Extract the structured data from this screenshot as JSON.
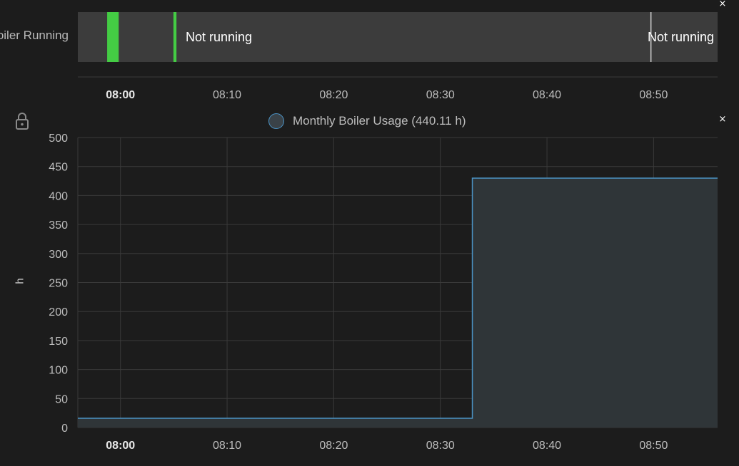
{
  "timeline": {
    "entity_label": "Boiler Running",
    "close_label": "×",
    "segments": [
      {
        "start": "07:58:45",
        "end": "07:59:50",
        "state": "Running",
        "color": "#44cc44"
      },
      {
        "start": "08:00:10",
        "end": "08:04:58",
        "state": "Not running",
        "color": "#3c3c3c"
      },
      {
        "start": "08:04:58",
        "end": "08:05:15",
        "state": "Running",
        "color": "#44cc44"
      },
      {
        "start": "08:05:15",
        "end": "08:49:45",
        "state": "Not running",
        "color": "#3c3c3c"
      },
      {
        "start": "08:49:45",
        "end": "08:56:00",
        "state": "Not running",
        "color": "#3c3c3c"
      }
    ],
    "segment_text": [
      "Not running",
      "Not running"
    ],
    "ticks": [
      "08:00",
      "08:10",
      "08:20",
      "08:30",
      "08:40",
      "08:50"
    ]
  },
  "chart_data": {
    "type": "area",
    "step": true,
    "legend": "Monthly Boiler Usage (440.11 h)",
    "ylabel": "h",
    "xlabel": "",
    "x_ticks": [
      "08:00",
      "08:10",
      "08:20",
      "08:30",
      "08:40",
      "08:50"
    ],
    "x_range": [
      "07:56",
      "08:56"
    ],
    "ylim": [
      0,
      500
    ],
    "y_ticks": [
      0,
      50,
      100,
      150,
      200,
      250,
      300,
      350,
      400,
      450,
      500
    ],
    "grid": true,
    "series": [
      {
        "name": "Monthly Boiler Usage (440.11 h)",
        "color": "#4b93c5",
        "fill": "#2f3538",
        "points": [
          {
            "x": "07:56",
            "y": 16
          },
          {
            "x": "08:33",
            "y": 16
          },
          {
            "x": "08:33",
            "y": 430
          },
          {
            "x": "08:56",
            "y": 430
          }
        ]
      }
    ],
    "close_label": "×"
  },
  "colors": {
    "background": "#1c1c1c",
    "grid": "#3a3a3a",
    "running": "#44cc44"
  }
}
